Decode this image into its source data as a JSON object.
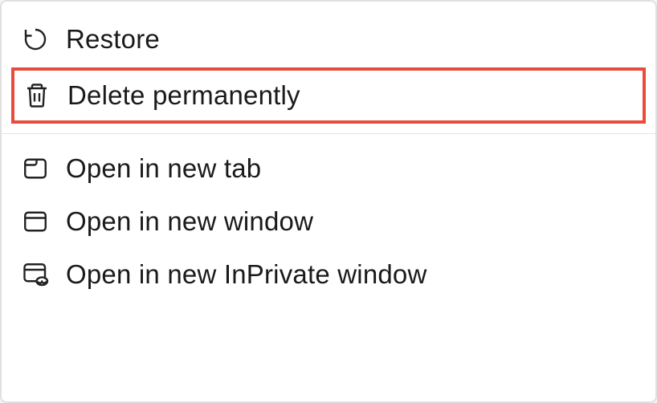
{
  "menu": {
    "section1": {
      "restore": {
        "label": "Restore"
      },
      "delete": {
        "label": "Delete permanently"
      }
    },
    "section2": {
      "newTab": {
        "label": "Open in new tab"
      },
      "newWindow": {
        "label": "Open in new window"
      },
      "inPrivate": {
        "label": "Open in new InPrivate window"
      }
    }
  }
}
